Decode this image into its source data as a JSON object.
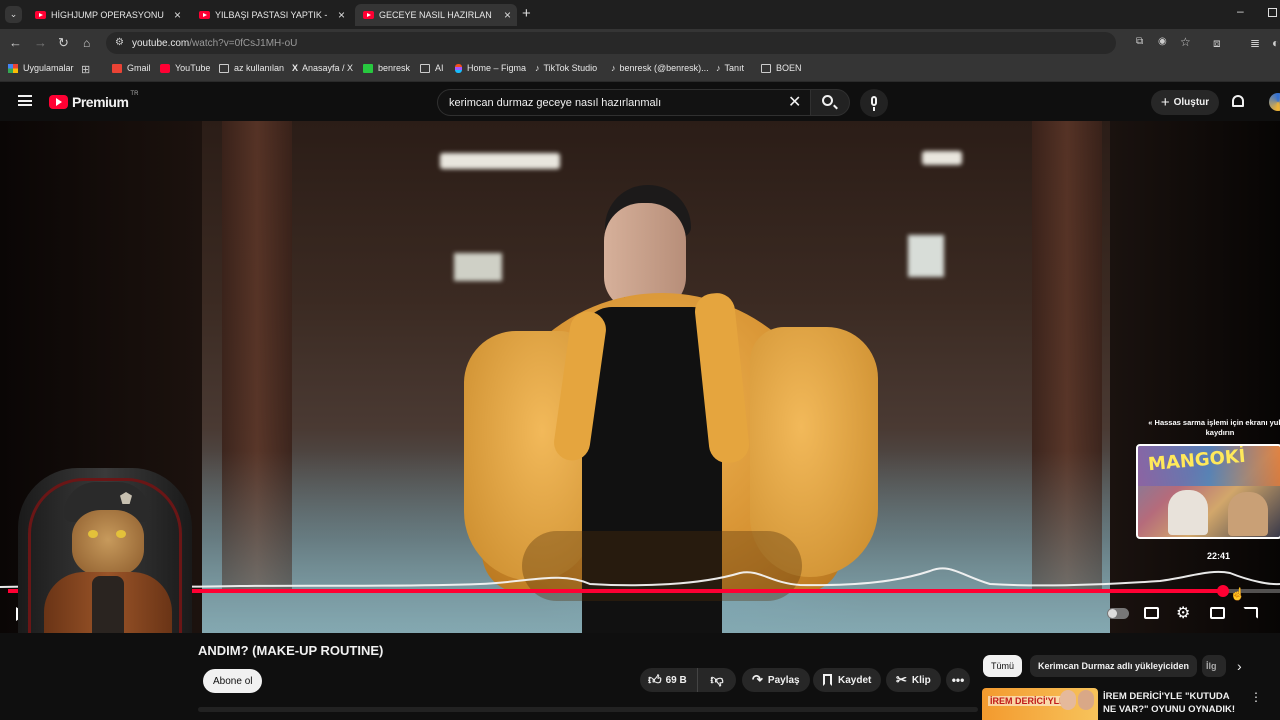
{
  "browser": {
    "tabs": [
      {
        "title": "HİGHJUMP OPERASYONU - Ar",
        "active": false
      },
      {
        "title": "YILBAŞI PASTASI YAPTIK - YouT",
        "active": false
      },
      {
        "title": "GECEYE NASIL HAZIRLANDIM?",
        "active": true
      }
    ],
    "url_host": "youtube.com",
    "url_path": "/watch?v=0fCsJ1MH-oU",
    "bookmarks": [
      "Uygulamalar",
      "Gmail",
      "YouTube",
      "az kullanılan",
      "Anasayfa / X",
      "benresk",
      "AI",
      "Home – Figma",
      "TikTok Studio",
      "benresk (@benresk)...",
      "Tanıt",
      "BOEN"
    ]
  },
  "youtube": {
    "logo_text": "Premium",
    "logo_badge": "TR",
    "search_query": "kerimcan durmaz geceye nasıl hazırlanmalı",
    "create_label": "Oluştur"
  },
  "player": {
    "seek_hint": "Hassas sarma işlemi için ekranı yukarı kaydırın",
    "preview_time": "22:41",
    "preview_thumb_text": "MANGOKİ",
    "progress_fraction": 0.955
  },
  "video": {
    "title": "ANDIM? (MAKE-UP ROUTINE)",
    "subscribe_label": "Abone ol",
    "like_count": "69 B",
    "share_label": "Paylaş",
    "save_label": "Kaydet",
    "clip_label": "Klip"
  },
  "related": {
    "chips": [
      "Tümü",
      "Kerimcan Durmaz adlı yükleyiciden",
      "İlg"
    ],
    "first_title": "İREM DERİCİ'YLE \"KUTUDA NE VAR?\" OYUNU OYNADIK!",
    "first_thumb_text": "İREM DERİCİ'YLE"
  },
  "colors": {
    "youtube_red": "#ff0033",
    "progress_red": "#f03",
    "jacket_yellow": "#e7a53f"
  }
}
